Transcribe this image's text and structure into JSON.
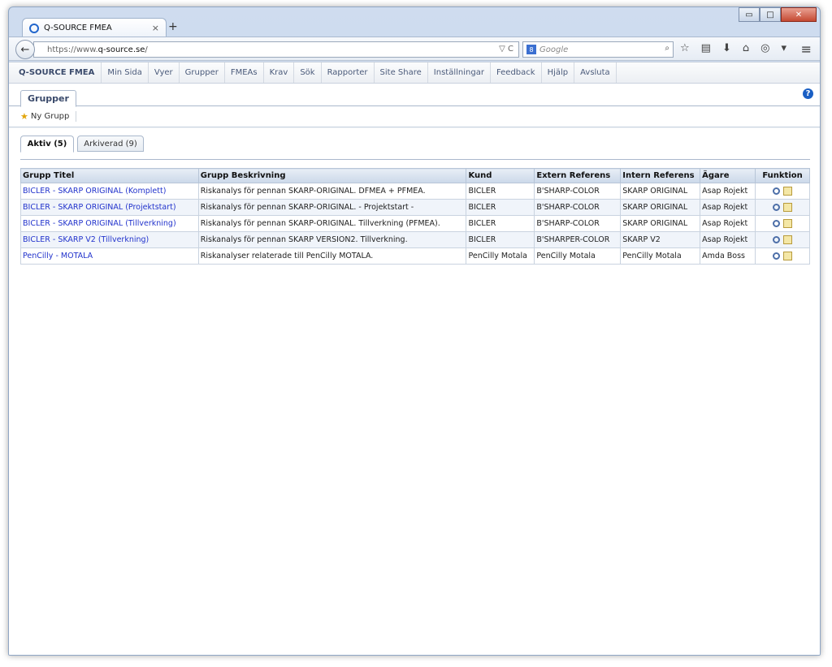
{
  "browser": {
    "tab_title": "Q-SOURCE FMEA",
    "tab_close": "×",
    "new_tab": "+",
    "url_proto": "https://www.",
    "url_host": "q-source.se",
    "url_rest": "/",
    "search_placeholder": "Google",
    "search_engine": "8",
    "url_icons": "▽ C",
    "window_min": "▭",
    "window_max": "□",
    "window_close": "✕",
    "back_glyph": "←",
    "tools": [
      "☆",
      "▤",
      "⬇",
      "⌂",
      "◎",
      "▾"
    ],
    "menu_glyph": "≡",
    "search_glyph": "⌕"
  },
  "app": {
    "brand": "Q-SOURCE FMEA",
    "menu": [
      "Min Sida",
      "Vyer",
      "Grupper",
      "FMEAs",
      "Krav",
      "Sök",
      "Rapporter",
      "Site Share",
      "Inställningar",
      "Feedback",
      "Hjälp",
      "Avsluta"
    ],
    "section_tab": "Grupper",
    "help_glyph": "?",
    "new_group_label": "Ny Grupp",
    "star_glyph": "★",
    "subtabs": [
      {
        "label": "Aktiv (5)",
        "active": true
      },
      {
        "label": "Arkiverad (9)",
        "active": false
      }
    ]
  },
  "table": {
    "headers": [
      "Grupp Titel",
      "Grupp Beskrivning",
      "Kund",
      "Extern Referens",
      "Intern Referens",
      "Ägare",
      "Funktion"
    ],
    "rows": [
      [
        "BICLER - SKARP ORIGINAL (Komplett)",
        "Riskanalys för pennan SKARP-ORIGINAL. DFMEA + PFMEA.",
        "BICLER",
        "B'SHARP-COLOR",
        "SKARP ORIGINAL",
        "Asap Rojekt"
      ],
      [
        "BICLER - SKARP ORIGINAL (Projektstart)",
        "Riskanalys för pennan SKARP-ORIGINAL. - Projektstart -",
        "BICLER",
        "B'SHARP-COLOR",
        "SKARP ORIGINAL",
        "Asap Rojekt"
      ],
      [
        "BICLER - SKARP ORIGINAL (Tillverkning)",
        "Riskanalys för pennan SKARP-ORIGINAL. Tillverkning (PFMEA).",
        "BICLER",
        "B'SHARP-COLOR",
        "SKARP ORIGINAL",
        "Asap Rojekt"
      ],
      [
        "BICLER - SKARP V2 (Tillverkning)",
        "Riskanalys för pennan SKARP VERSION2. Tillverkning.",
        "BICLER",
        "B'SHARPER-COLOR",
        "SKARP V2",
        "Asap Rojekt"
      ],
      [
        "PenCilly - MOTALA",
        "Riskanalyser relaterade till PenCilly MOTALA.",
        "PenCilly Motala",
        "PenCilly Motala",
        "PenCilly Motala",
        "Amda Boss"
      ]
    ]
  }
}
